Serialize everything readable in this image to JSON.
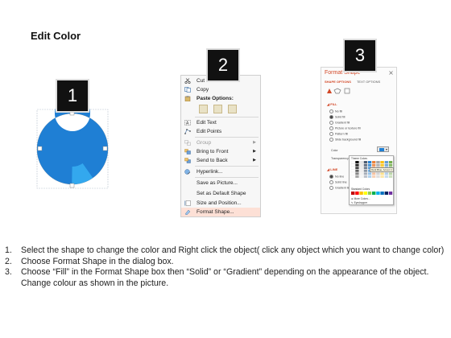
{
  "title": "Edit Color",
  "badges": [
    "1",
    "2",
    "3"
  ],
  "context_menu": {
    "items": [
      {
        "label": "Cut",
        "icon": "scissors-icon"
      },
      {
        "label": "Copy",
        "icon": "copy-icon"
      },
      {
        "label": "Paste Options:",
        "icon": "paste-icon"
      },
      {
        "label": "Edit Text",
        "icon": "edit-text-icon"
      },
      {
        "label": "Edit Points",
        "icon": "edit-points-icon"
      },
      {
        "label": "Group",
        "icon": "group-icon"
      },
      {
        "label": "Bring to Front",
        "icon": "bring-front-icon"
      },
      {
        "label": "Send to Back",
        "icon": "send-back-icon"
      },
      {
        "label": "Hyperlink...",
        "icon": "hyperlink-icon"
      },
      {
        "label": "Save as Picture...",
        "icon": ""
      },
      {
        "label": "Set as Default Shape",
        "icon": ""
      },
      {
        "label": "Size and Position...",
        "icon": "size-position-icon"
      },
      {
        "label": "Format Shape...",
        "icon": "format-shape-icon"
      }
    ]
  },
  "format_pane": {
    "title": "Format Shape",
    "tabs": [
      "SHAPE OPTIONS",
      "TEXT OPTIONS"
    ],
    "fill_header": "FILL",
    "fill_options": [
      "No fill",
      "Solid fill",
      "Gradient fill",
      "Picture or texture fill",
      "Pattern fill",
      "Slide background fill"
    ],
    "color_label": "Color",
    "transparency_label": "Transparency",
    "line_header": "LINE",
    "line_options": [
      "No line",
      "Solid line",
      "Gradient line"
    ],
    "palette": {
      "theme_header": "Theme Colors",
      "tooltip": "Dark Blue, Accent 1",
      "standard_header": "Standard Colors",
      "more_colors": "More Colors...",
      "eyedropper": "Eyedropper"
    }
  },
  "donut": {
    "main_color": "#1f7fd4",
    "highlight_color": "#33a8ee",
    "highlight_fraction": 0.1
  },
  "instructions": [
    {
      "num": "1.",
      "text": "Select the shape to change the color and Right click the object( click any object which you want to change color)"
    },
    {
      "num": "2.",
      "text": "Choose Format Shape in the dialog box."
    },
    {
      "num": "3.",
      "text": "Choose “Fill” in the Format Shape box then “Solid” or “Gradient” depending on the appearance of the object. Change colour as shown in the picture."
    }
  ]
}
